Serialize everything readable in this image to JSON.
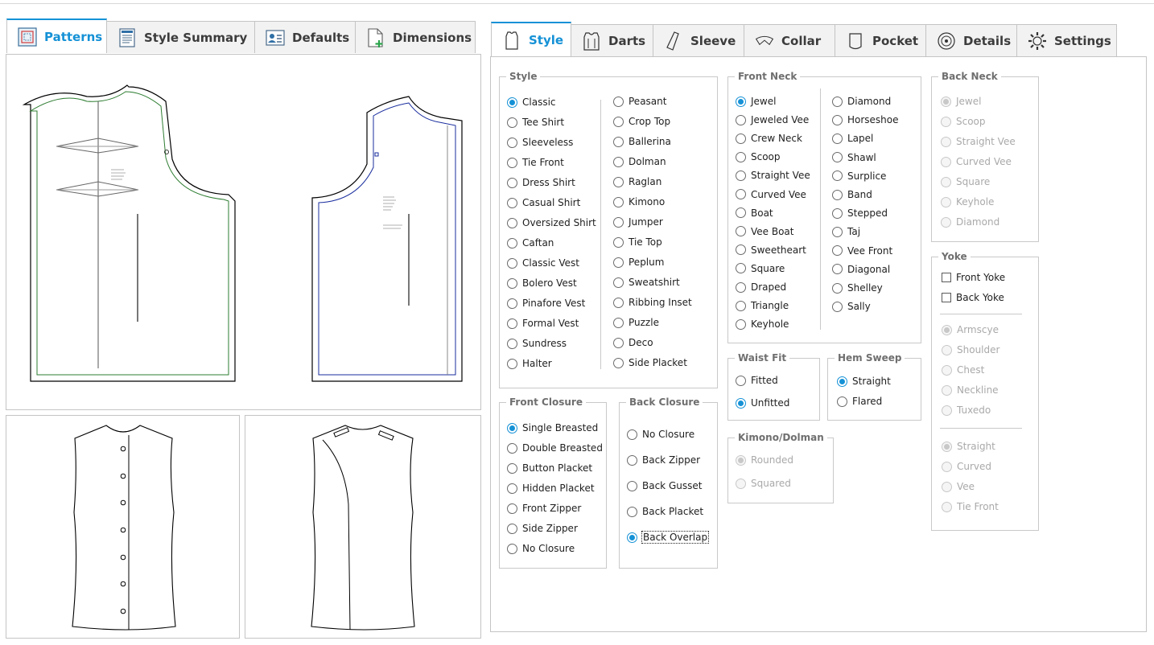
{
  "left_tabs": [
    {
      "label": "Patterns",
      "icon": "patterns-icon",
      "active": true
    },
    {
      "label": "Style Summary",
      "icon": "document-icon",
      "active": false
    },
    {
      "label": "Defaults",
      "icon": "user-card-icon",
      "active": false
    },
    {
      "label": "Dimensions",
      "icon": "page-add-icon",
      "active": false
    }
  ],
  "right_tabs": [
    {
      "label": "Style",
      "icon": "shirt-icon",
      "active": true
    },
    {
      "label": "Darts",
      "icon": "darts-icon",
      "active": false
    },
    {
      "label": "Sleeve",
      "icon": "sleeve-icon",
      "active": false
    },
    {
      "label": "Collar",
      "icon": "collar-icon",
      "active": false
    },
    {
      "label": "Pocket",
      "icon": "pocket-icon",
      "active": false
    },
    {
      "label": "Details",
      "icon": "details-icon",
      "active": false
    },
    {
      "label": "Settings",
      "icon": "gear-icon",
      "active": false
    }
  ],
  "accent_color": "#1591d6",
  "style_group": {
    "title": "Style",
    "col1": [
      "Classic",
      "Tee Shirt",
      "Sleeveless",
      "Tie Front",
      "Dress Shirt",
      "Casual Shirt",
      "Oversized Shirt",
      "Caftan",
      "Classic Vest",
      "Bolero Vest",
      "Pinafore Vest",
      "Formal Vest",
      "Sundress",
      "Halter"
    ],
    "col2": [
      "Peasant",
      "Crop Top",
      "Ballerina",
      "Dolman",
      "Raglan",
      "Kimono",
      "Jumper",
      "Tie Top",
      "Peplum",
      "Sweatshirt",
      "Ribbing Inset",
      "Puzzle",
      "Deco",
      "Side Placket"
    ],
    "selected": "Classic"
  },
  "front_neck_group": {
    "title": "Front Neck",
    "col1": [
      "Jewel",
      "Jeweled Vee",
      "Crew Neck",
      "Scoop",
      "Straight Vee",
      "Curved Vee",
      "Boat",
      "Vee Boat",
      "Sweetheart",
      "Square",
      "Draped",
      "Triangle",
      "Keyhole"
    ],
    "col2": [
      "Diamond",
      "Horseshoe",
      "Lapel",
      "Shawl",
      "Surplice",
      "Band",
      "Stepped",
      "Taj",
      "Vee Front",
      "Diagonal",
      "Shelley",
      "Sally"
    ],
    "selected": "Jewel"
  },
  "back_neck_group": {
    "title": "Back Neck",
    "options": [
      "Jewel",
      "Scoop",
      "Straight Vee",
      "Curved Vee",
      "Square",
      "Keyhole",
      "Diamond"
    ],
    "selected": "Jewel",
    "disabled": true
  },
  "yoke_group": {
    "title": "Yoke",
    "checks": [
      "Front Yoke",
      "Back Yoke"
    ],
    "radios1": [
      "Armscye",
      "Shoulder",
      "Chest",
      "Neckline",
      "Tuxedo"
    ],
    "radios1_selected": "Armscye",
    "radios2": [
      "Straight",
      "Curved",
      "Vee",
      "Tie Front"
    ],
    "radios2_selected": "Straight"
  },
  "waist_fit_group": {
    "title": "Waist Fit",
    "options": [
      "Fitted",
      "Unfitted"
    ],
    "selected": "Unfitted"
  },
  "hem_sweep_group": {
    "title": "Hem Sweep",
    "options": [
      "Straight",
      "Flared"
    ],
    "selected": "Straight"
  },
  "kimono_group": {
    "title": "Kimono/Dolman",
    "options": [
      "Rounded",
      "Squared"
    ],
    "selected": "Rounded",
    "disabled": true
  },
  "front_closure_group": {
    "title": "Front Closure",
    "options": [
      "Single Breasted",
      "Double Breasted",
      "Button Placket",
      "Hidden Placket",
      "Front Zipper",
      "Side Zipper",
      "No Closure"
    ],
    "selected": "Single Breasted"
  },
  "back_closure_group": {
    "title": "Back Closure",
    "options": [
      "No Closure",
      "Back Zipper",
      "Back Gusset",
      "Back Placket",
      "Back Overlap"
    ],
    "selected": "Back Overlap"
  }
}
